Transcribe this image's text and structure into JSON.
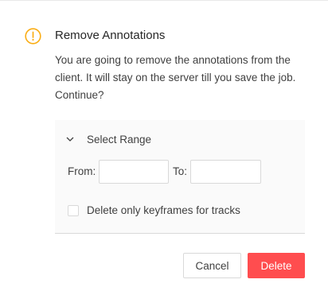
{
  "dialog": {
    "title": "Remove Annotations",
    "message": "You are going to remove the annotations from the client. It will stay on the server till you save the job. Continue?",
    "icon": "exclamation-circle-icon",
    "icon_color": "#faad14"
  },
  "range": {
    "header": "Select Range",
    "expanded": true,
    "from_label": "From:",
    "from_value": "",
    "to_label": "To:",
    "to_value": "",
    "keyframes_label": "Delete only keyframes for tracks",
    "keyframes_checked": false
  },
  "buttons": {
    "cancel": "Cancel",
    "delete": "Delete",
    "delete_color": "#ff4d4f"
  }
}
